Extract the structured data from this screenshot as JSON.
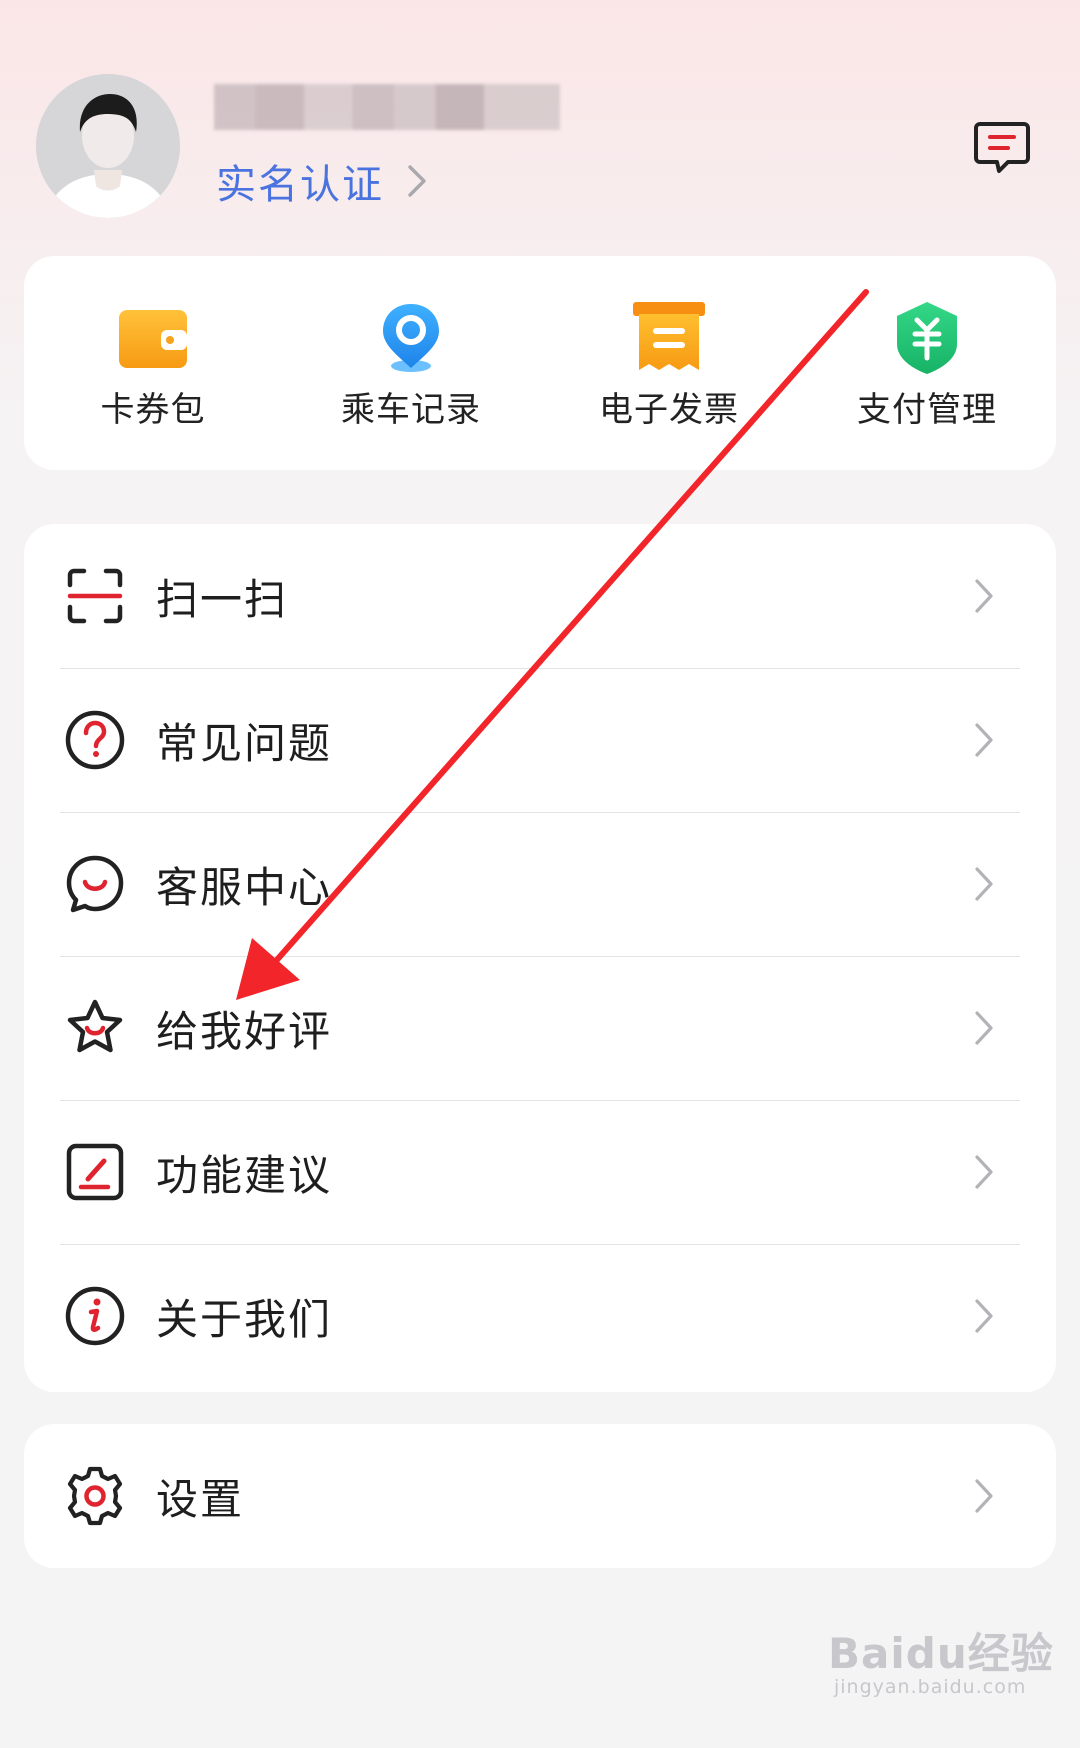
{
  "header": {
    "realname_label": "实名认证"
  },
  "quick_actions": [
    {
      "label": "卡券包",
      "icon": "wallet-icon",
      "color": "#f7a21b"
    },
    {
      "label": "乘车记录",
      "icon": "location-pin-icon",
      "color": "#2a95f5"
    },
    {
      "label": "电子发票",
      "icon": "invoice-icon",
      "color": "#f7a21b"
    },
    {
      "label": "支付管理",
      "icon": "yuan-shield-icon",
      "color": "#27c67a"
    }
  ],
  "menu": [
    {
      "label": "扫一扫",
      "icon": "scan-icon"
    },
    {
      "label": "常见问题",
      "icon": "question-icon"
    },
    {
      "label": "客服中心",
      "icon": "chat-bubble-icon"
    },
    {
      "label": "给我好评",
      "icon": "star-icon"
    },
    {
      "label": "功能建议",
      "icon": "edit-icon"
    },
    {
      "label": "关于我们",
      "icon": "info-icon"
    }
  ],
  "settings": {
    "label": "设置",
    "icon": "gear-icon"
  },
  "accent_color": "#e0242f",
  "link_color": "#4a73e0",
  "watermark": {
    "top": "Baidu经验",
    "bottom": "jingyan.baidu.com"
  }
}
